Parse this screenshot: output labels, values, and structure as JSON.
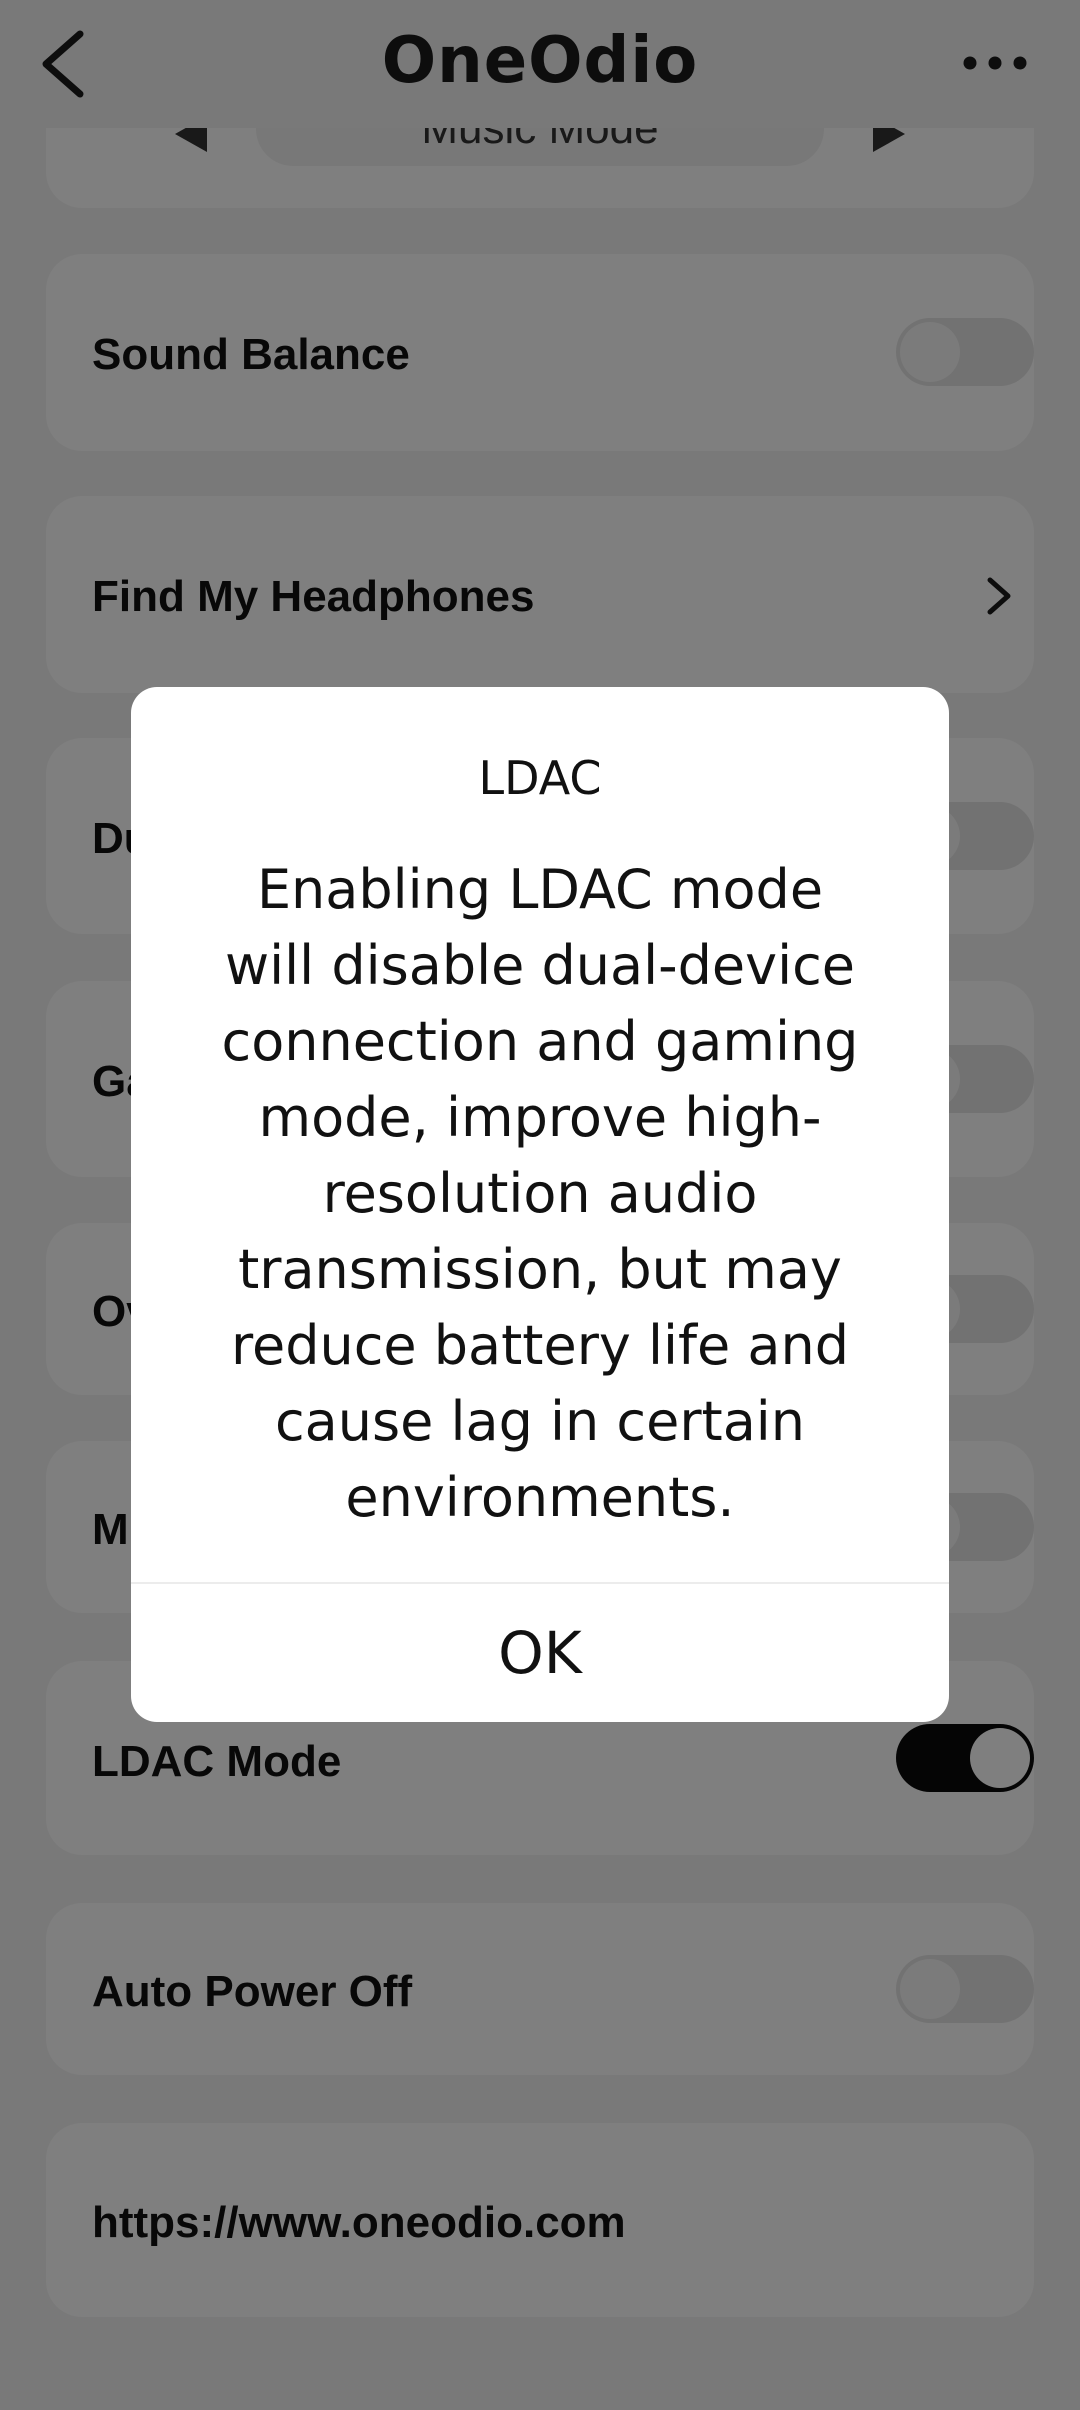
{
  "header": {
    "title": "OneOdio",
    "back_icon": "chevron-left-icon",
    "more_icon": "more-horizontal-icon"
  },
  "eq_card": {
    "mode_label": "Music Mode"
  },
  "settings": [
    {
      "label": "Sound Balance",
      "control": "toggle",
      "on": false
    },
    {
      "label": "Find My Headphones",
      "control": "chevron"
    },
    {
      "label": "Du",
      "control": "toggle",
      "on": false
    },
    {
      "label": "Ga",
      "control": "toggle",
      "on": false
    },
    {
      "label": "Ov",
      "control": "toggle",
      "on": false
    },
    {
      "label": "M",
      "control": "toggle",
      "on": false
    },
    {
      "label": "LDAC Mode",
      "control": "toggle",
      "on": true
    },
    {
      "label": "Auto Power Off",
      "control": "toggle",
      "on": false
    },
    {
      "label": "https://www.oneodio.com",
      "control": "none"
    }
  ],
  "dialog": {
    "title": "LDAC",
    "message": "Enabling LDAC mode will disable dual-device connection and gaming mode, improve high-resolution audio transmission, but may reduce battery life and cause lag in certain environments.",
    "ok_label": "OK"
  },
  "colors": {
    "background": "#f2f2f2",
    "card": "#ffffff",
    "toggle_on": "#0a0a0a",
    "toggle_off": "#e4e4e4",
    "overlay": "rgba(0,0,0,0.5)"
  }
}
